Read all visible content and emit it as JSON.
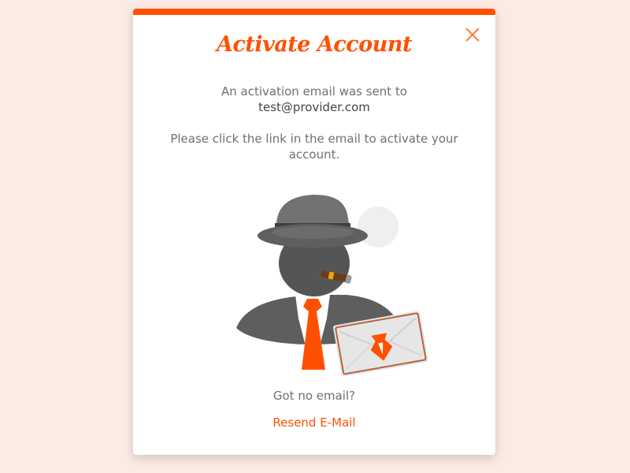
{
  "modal": {
    "title": "Activate Account",
    "message_line1": "An activation email was sent to",
    "email": "test@provider.com",
    "instruction": "Please click the link in the email to activate your account.",
    "no_email_text": "Got no email?",
    "resend_label": "Resend E-Mail",
    "close_icon": "close-icon"
  },
  "colors": {
    "accent": "#ff5000",
    "background": "#fcebe4",
    "text": "#6f6f6f"
  }
}
